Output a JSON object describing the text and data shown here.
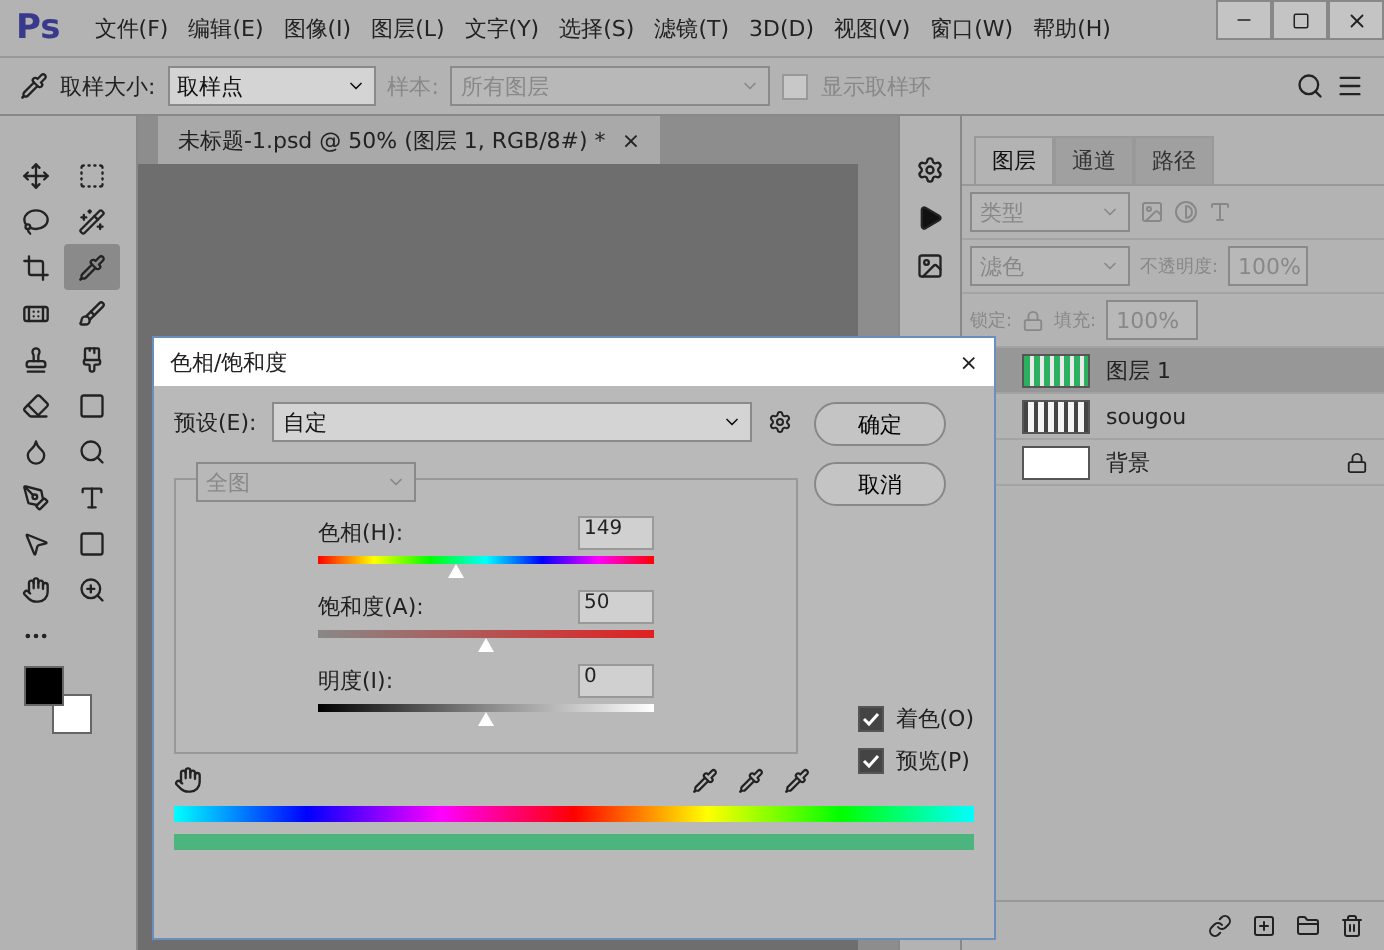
{
  "app": {
    "logo": "Ps",
    "menu": [
      "文件(F)",
      "编辑(E)",
      "图像(I)",
      "图层(L)",
      "文字(Y)",
      "选择(S)",
      "滤镜(T)",
      "3D(D)",
      "视图(V)",
      "窗口(W)",
      "帮助(H)"
    ]
  },
  "options_bar": {
    "sample_size_label": "取样大小:",
    "sample_size": "取样点",
    "sample_label": "样本:",
    "sample": "所有图层",
    "show_ring": {
      "label": "显示取样环",
      "checked": false
    }
  },
  "document_tab": {
    "title": "未标题-1.psd @ 50% (图层 1, RGB/8#) *",
    "close": "×"
  },
  "tools": [
    {
      "kind": "move",
      "selected": false
    },
    {
      "kind": "marquee",
      "selected": false
    },
    {
      "kind": "lasso",
      "selected": false
    },
    {
      "kind": "wand",
      "selected": false
    },
    {
      "kind": "crop",
      "selected": false
    },
    {
      "kind": "eyedropper",
      "selected": true
    },
    {
      "kind": "heal",
      "selected": false
    },
    {
      "kind": "brush",
      "selected": false
    },
    {
      "kind": "stamp",
      "selected": false
    },
    {
      "kind": "history",
      "selected": false
    },
    {
      "kind": "eraser",
      "selected": false
    },
    {
      "kind": "gradient",
      "selected": false
    },
    {
      "kind": "blur",
      "selected": false
    },
    {
      "kind": "dodge",
      "selected": false
    },
    {
      "kind": "pen",
      "selected": false
    },
    {
      "kind": "type",
      "selected": false
    },
    {
      "kind": "select",
      "selected": false
    },
    {
      "kind": "rect",
      "selected": false
    },
    {
      "kind": "hand",
      "selected": false
    },
    {
      "kind": "zoom",
      "selected": false
    },
    {
      "kind": "more",
      "selected": false
    }
  ],
  "layers_panel": {
    "tabs": [
      {
        "label": "图层",
        "selected": true
      },
      {
        "label": "通道",
        "selected": false
      },
      {
        "label": "路径",
        "selected": false
      }
    ],
    "filter": "类型",
    "blend_mode": "滤色",
    "opacity_label": "不透明度:",
    "opacity": "100%",
    "lock_label": "锁定:",
    "fill_label": "填充:",
    "fill": "100%",
    "layers": [
      {
        "name": "图层 1",
        "selected": true,
        "locked": false,
        "kind": "pixel"
      },
      {
        "name": "sougou",
        "selected": false,
        "locked": false,
        "kind": "text"
      },
      {
        "name": "背景",
        "selected": false,
        "locked": true,
        "kind": "fill"
      }
    ]
  },
  "dialog": {
    "title": "色相/饱和度",
    "close": "×",
    "preset_label": "预设(E):",
    "preset": "自定",
    "ok": "确定",
    "cancel": "取消",
    "channel": "全图",
    "sliders": [
      {
        "kind": "hue",
        "label": "色相(H):",
        "value": "149",
        "level": 0.41
      },
      {
        "kind": "saturation",
        "label": "饱和度(A):",
        "value": "50",
        "level": 0.5
      },
      {
        "kind": "lightness",
        "label": "明度(I):",
        "value": "0",
        "level": 0.5
      }
    ],
    "checkboxes": [
      {
        "label": "着色(O)",
        "checked": true
      },
      {
        "label": "预览(P)",
        "checked": true
      }
    ]
  }
}
